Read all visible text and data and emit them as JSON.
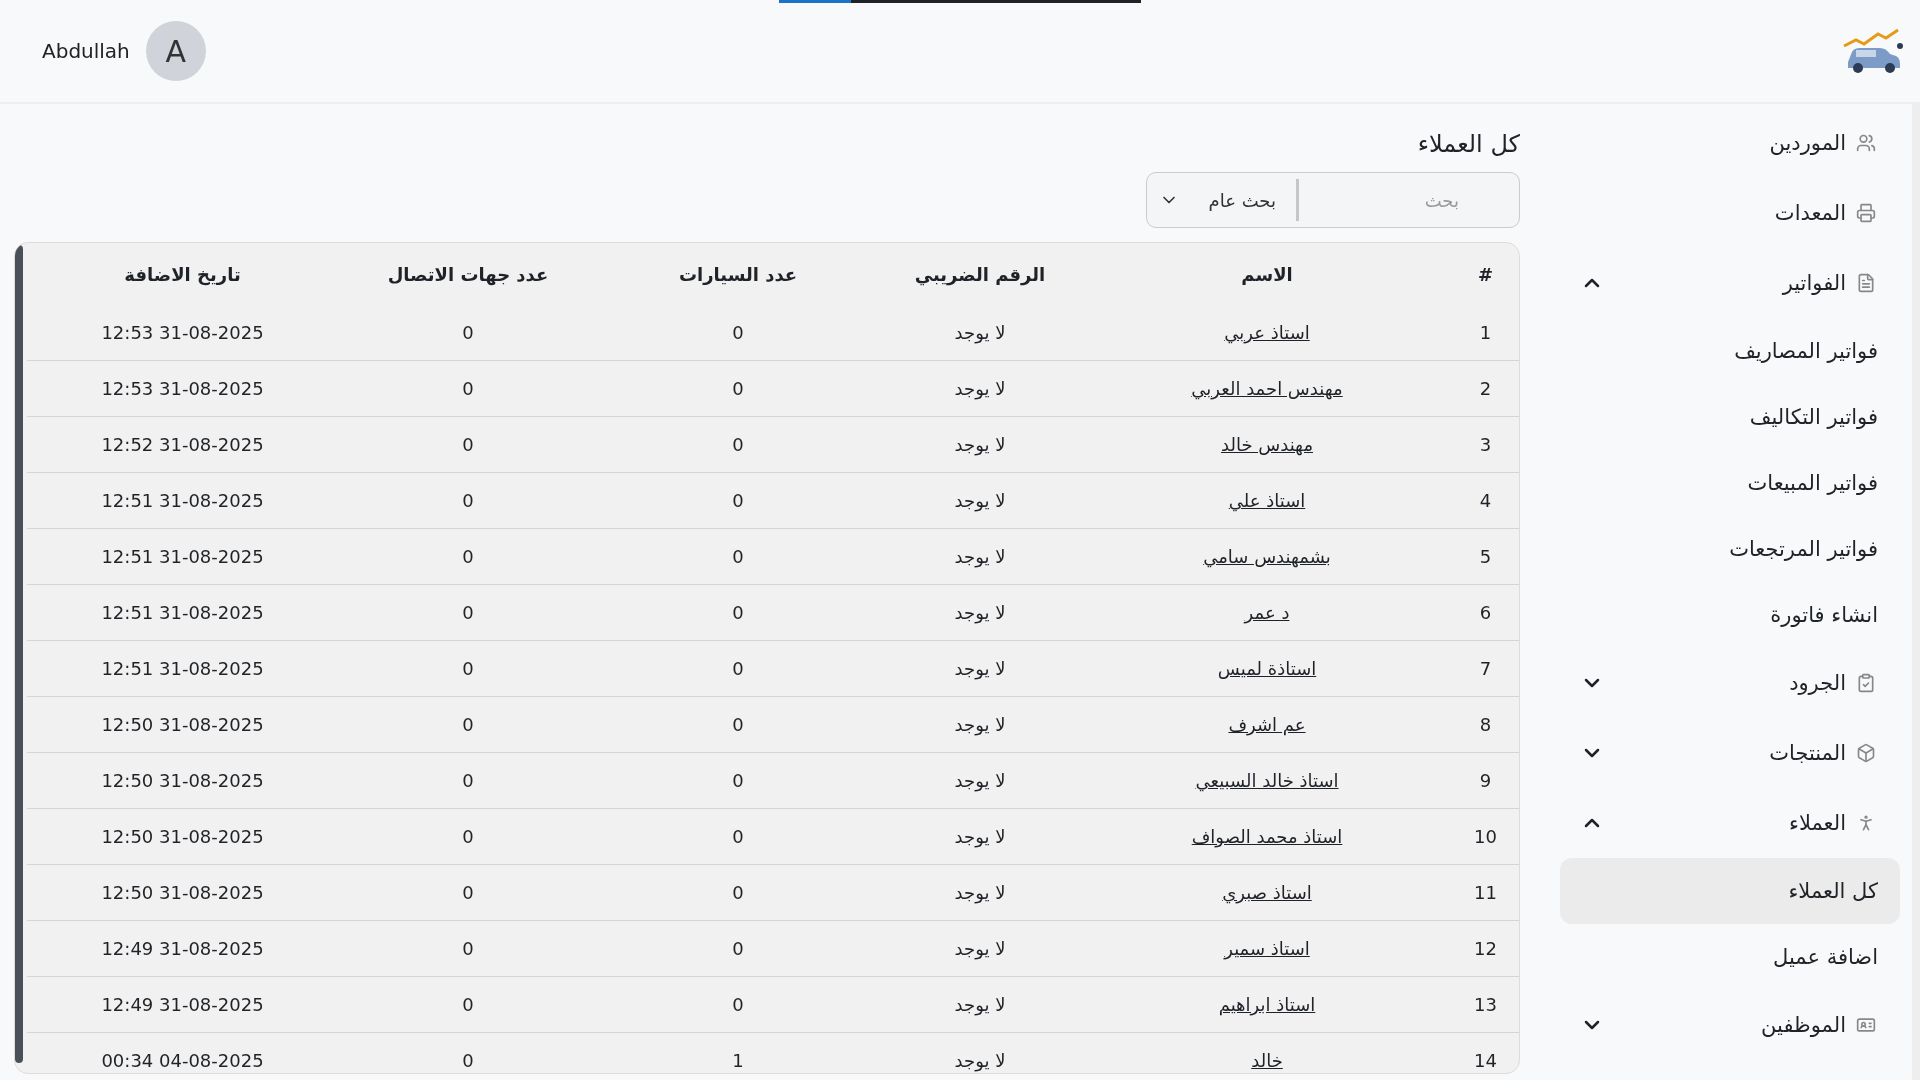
{
  "loading_bar": {
    "level": 0.2
  },
  "user": {
    "name": "Abdullah",
    "initial": "A"
  },
  "sidebar": {
    "items": [
      {
        "label": "الموردين",
        "kind": "link",
        "selected": false
      },
      {
        "label": "المعدات",
        "kind": "link",
        "selected": false
      },
      {
        "label": "الفواتير",
        "kind": "group",
        "selected": false,
        "expanded": true,
        "children": [
          {
            "label": "فواتير المصاريف",
            "selected": false
          },
          {
            "label": "فواتير التكاليف",
            "selected": false
          },
          {
            "label": "فواتير المبيعات",
            "selected": false
          },
          {
            "label": "فواتير المرتجعات",
            "selected": false
          },
          {
            "label": "انشاء فاتورة",
            "selected": false
          }
        ]
      },
      {
        "label": "الجرود",
        "kind": "group",
        "selected": false,
        "expanded": false
      },
      {
        "label": "المنتجات",
        "kind": "group",
        "selected": false,
        "expanded": false
      },
      {
        "label": "العملاء",
        "kind": "group",
        "selected": false,
        "expanded": true,
        "children": [
          {
            "label": "كل العملاء",
            "selected": true
          },
          {
            "label": "اضافة عميل",
            "selected": false
          }
        ]
      },
      {
        "label": "الموظفين",
        "kind": "group",
        "selected": false,
        "expanded": false
      }
    ]
  },
  "page": {
    "title": "كل العملاء"
  },
  "search": {
    "placeholder": "بحث",
    "scope": "بحث عام"
  },
  "table": {
    "columns": [
      "#",
      "الاسم",
      "الرقم الضريبي",
      "عدد السيارات",
      "عدد جهات الاتصال",
      "تاريخ الاضافة"
    ],
    "rows": [
      {
        "number": "1",
        "name": "استاذ عربي",
        "tax_number": "لا يوجد",
        "cars": "0",
        "contacts": "0",
        "added": "12:53 31-08-2025"
      },
      {
        "number": "2",
        "name": "مهندس احمد العربي",
        "tax_number": "لا يوجد",
        "cars": "0",
        "contacts": "0",
        "added": "12:53 31-08-2025"
      },
      {
        "number": "3",
        "name": "مهندس خالد",
        "tax_number": "لا يوجد",
        "cars": "0",
        "contacts": "0",
        "added": "12:52 31-08-2025"
      },
      {
        "number": "4",
        "name": "استاذ علي",
        "tax_number": "لا يوجد",
        "cars": "0",
        "contacts": "0",
        "added": "12:51 31-08-2025"
      },
      {
        "number": "5",
        "name": "بشمهندس سامي",
        "tax_number": "لا يوجد",
        "cars": "0",
        "contacts": "0",
        "added": "12:51 31-08-2025"
      },
      {
        "number": "6",
        "name": "د عمر",
        "tax_number": "لا يوجد",
        "cars": "0",
        "contacts": "0",
        "added": "12:51 31-08-2025"
      },
      {
        "number": "7",
        "name": "استاذة لميس",
        "tax_number": "لا يوجد",
        "cars": "0",
        "contacts": "0",
        "added": "12:51 31-08-2025"
      },
      {
        "number": "8",
        "name": "عم اشرف",
        "tax_number": "لا يوجد",
        "cars": "0",
        "contacts": "0",
        "added": "12:50 31-08-2025"
      },
      {
        "number": "9",
        "name": "استاذ خالد السبيعي",
        "tax_number": "لا يوجد",
        "cars": "0",
        "contacts": "0",
        "added": "12:50 31-08-2025"
      },
      {
        "number": "10",
        "name": "استاذ محمد الصواف",
        "tax_number": "لا يوجد",
        "cars": "0",
        "contacts": "0",
        "added": "12:50 31-08-2025"
      },
      {
        "number": "11",
        "name": "استاذ صبري",
        "tax_number": "لا يوجد",
        "cars": "0",
        "contacts": "0",
        "added": "12:50 31-08-2025"
      },
      {
        "number": "12",
        "name": "استاذ سمير",
        "tax_number": "لا يوجد",
        "cars": "0",
        "contacts": "0",
        "added": "12:49 31-08-2025"
      },
      {
        "number": "13",
        "name": "استاذ ابراهيم",
        "tax_number": "لا يوجد",
        "cars": "0",
        "contacts": "0",
        "added": "12:49 31-08-2025"
      },
      {
        "number": "14",
        "name": "خالد",
        "tax_number": "لا يوجد",
        "cars": "1",
        "contacts": "0",
        "added": "00:34 04-08-2025"
      }
    ]
  }
}
